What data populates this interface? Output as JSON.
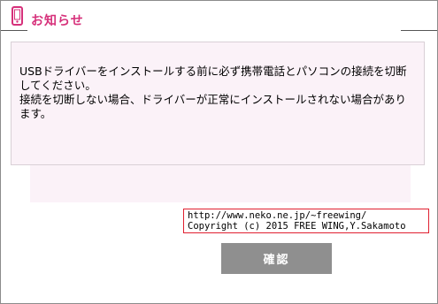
{
  "dialog": {
    "title": "お知らせ",
    "icon": "phone-icon",
    "accent_color": "#d6307a",
    "message": "USBドライバーをインストールする前に必ず携帯電話とパソコンの接続を切断してください。\n接続を切断しない場合、ドライバーが正常にインストールされない場合があります。"
  },
  "credits": {
    "url": "http://www.neko.ne.jp/~freewing/",
    "copyright": "Copyright (c) 2015 FREE WING,Y.Sakamoto",
    "border_color": "#e02030"
  },
  "buttons": {
    "ok_label": "確認"
  }
}
